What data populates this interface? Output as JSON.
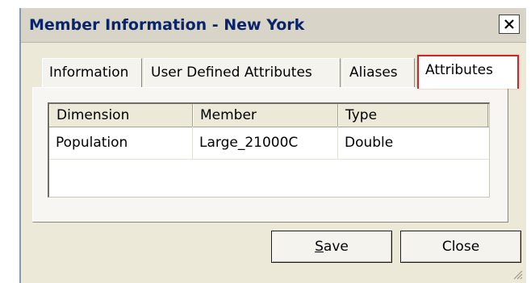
{
  "window": {
    "title": "Member Information - New York"
  },
  "tabs": [
    {
      "label": "Information",
      "active": false
    },
    {
      "label": "User Defined Attributes",
      "active": false
    },
    {
      "label": "Aliases",
      "active": false
    },
    {
      "label": "Attributes",
      "active": true
    }
  ],
  "grid": {
    "columns": [
      "Dimension",
      "Member",
      "Type"
    ],
    "rows": [
      [
        "Population",
        "Large_21000C",
        "Double"
      ]
    ]
  },
  "buttons": {
    "save_label": "Save",
    "save_accesskey": "S",
    "close_label": "Close"
  },
  "colors": {
    "highlight": "#c8282c",
    "title_text": "#0a246a"
  }
}
